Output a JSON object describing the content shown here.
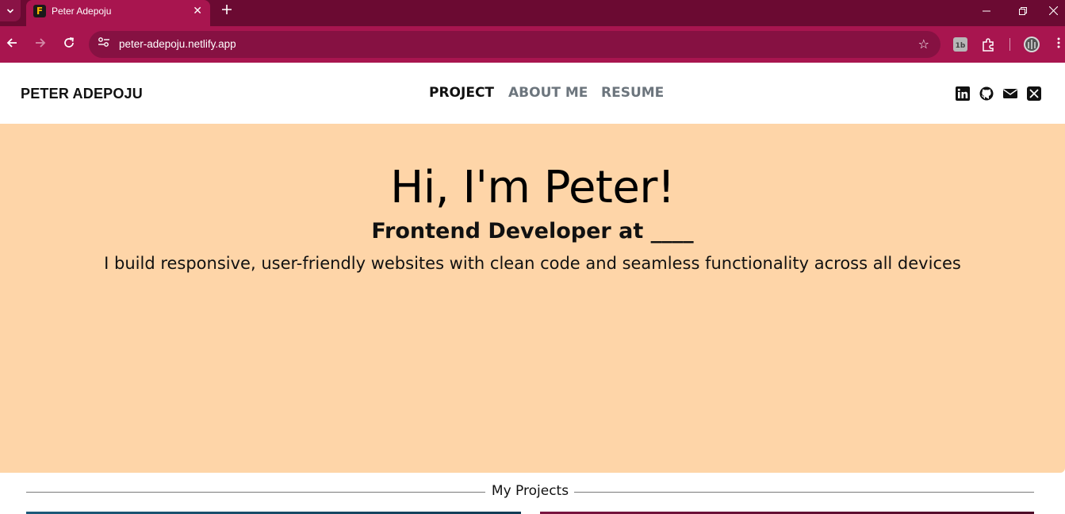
{
  "browser": {
    "tab_title": "Peter Adepoju",
    "favicon_letter": "F",
    "url": "peter-adepoju.netlify.app"
  },
  "header": {
    "brand": "PETER ADEPOJU",
    "nav": [
      {
        "label": "PROJECT",
        "active": true
      },
      {
        "label": "ABOUT ME",
        "active": false
      },
      {
        "label": "RESUME",
        "active": false
      }
    ],
    "social_icons": [
      "linkedin-icon",
      "github-icon",
      "mail-icon",
      "x-icon"
    ]
  },
  "hero": {
    "heading": "Hi, I'm Peter!",
    "subheading": "Frontend Developer at ____",
    "tagline": "I build responsive, user-friendly websites with clean code and seamless functionality across all devices",
    "background": "#fed5a8"
  },
  "projects": {
    "section_title": "My Projects"
  },
  "colors": {
    "chrome_dark": "#6b0a32",
    "chrome": "#a8154f",
    "omnibox": "#861142"
  }
}
